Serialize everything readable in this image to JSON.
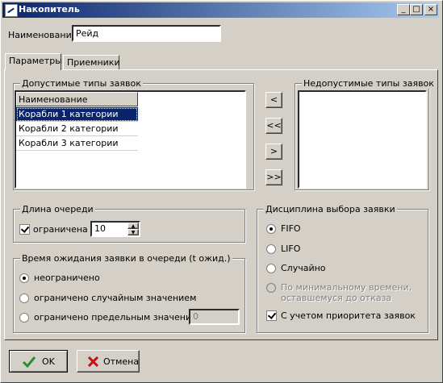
{
  "window": {
    "title": "Накопитель",
    "buttons": [
      "_",
      "□",
      "×"
    ]
  },
  "name_field": {
    "label": "Наименование",
    "value": "Рейд"
  },
  "tabs": [
    {
      "label": "Параметры",
      "active": true
    },
    {
      "label": "Приемники",
      "active": false
    }
  ],
  "allowed": {
    "title": "Допустимые типы заявок",
    "column_header": "Наименование",
    "rows": [
      "Корабли 1 категории",
      "Корабли 2 категории",
      "Корабли 3 категории"
    ],
    "selected_index": 0
  },
  "disallowed": {
    "title": "Недопустимые типы заявок"
  },
  "transfer_buttons": [
    "<",
    "<<",
    ">",
    ">>"
  ],
  "queue_length": {
    "title": "Длина очереди",
    "limited_label": "ограничена",
    "limited_checked": true,
    "value": "10"
  },
  "wait_time": {
    "title": "Время ожидания заявки в очереди (t ожид.)",
    "options": [
      "неограничено",
      "ограничено случайным значением",
      "ограничено предельным значением"
    ],
    "selected_index": 0,
    "limit_value": "0"
  },
  "discipline": {
    "title": "Дисциплина выбора заявки",
    "options": [
      "FIFO",
      "LIFO",
      "Случайно",
      "По минимальному времени, оставшемуся до отказа"
    ],
    "selected_index": 0,
    "priority_label": "С учетом приоритета заявок",
    "priority_checked": true
  },
  "footer": {
    "ok_label": "OK",
    "cancel_label": "Отмена"
  },
  "icons": {
    "ok": "check-icon",
    "cancel": "cross-icon",
    "ok_color": "#2e8b2e",
    "cancel_color": "#cc1010"
  }
}
